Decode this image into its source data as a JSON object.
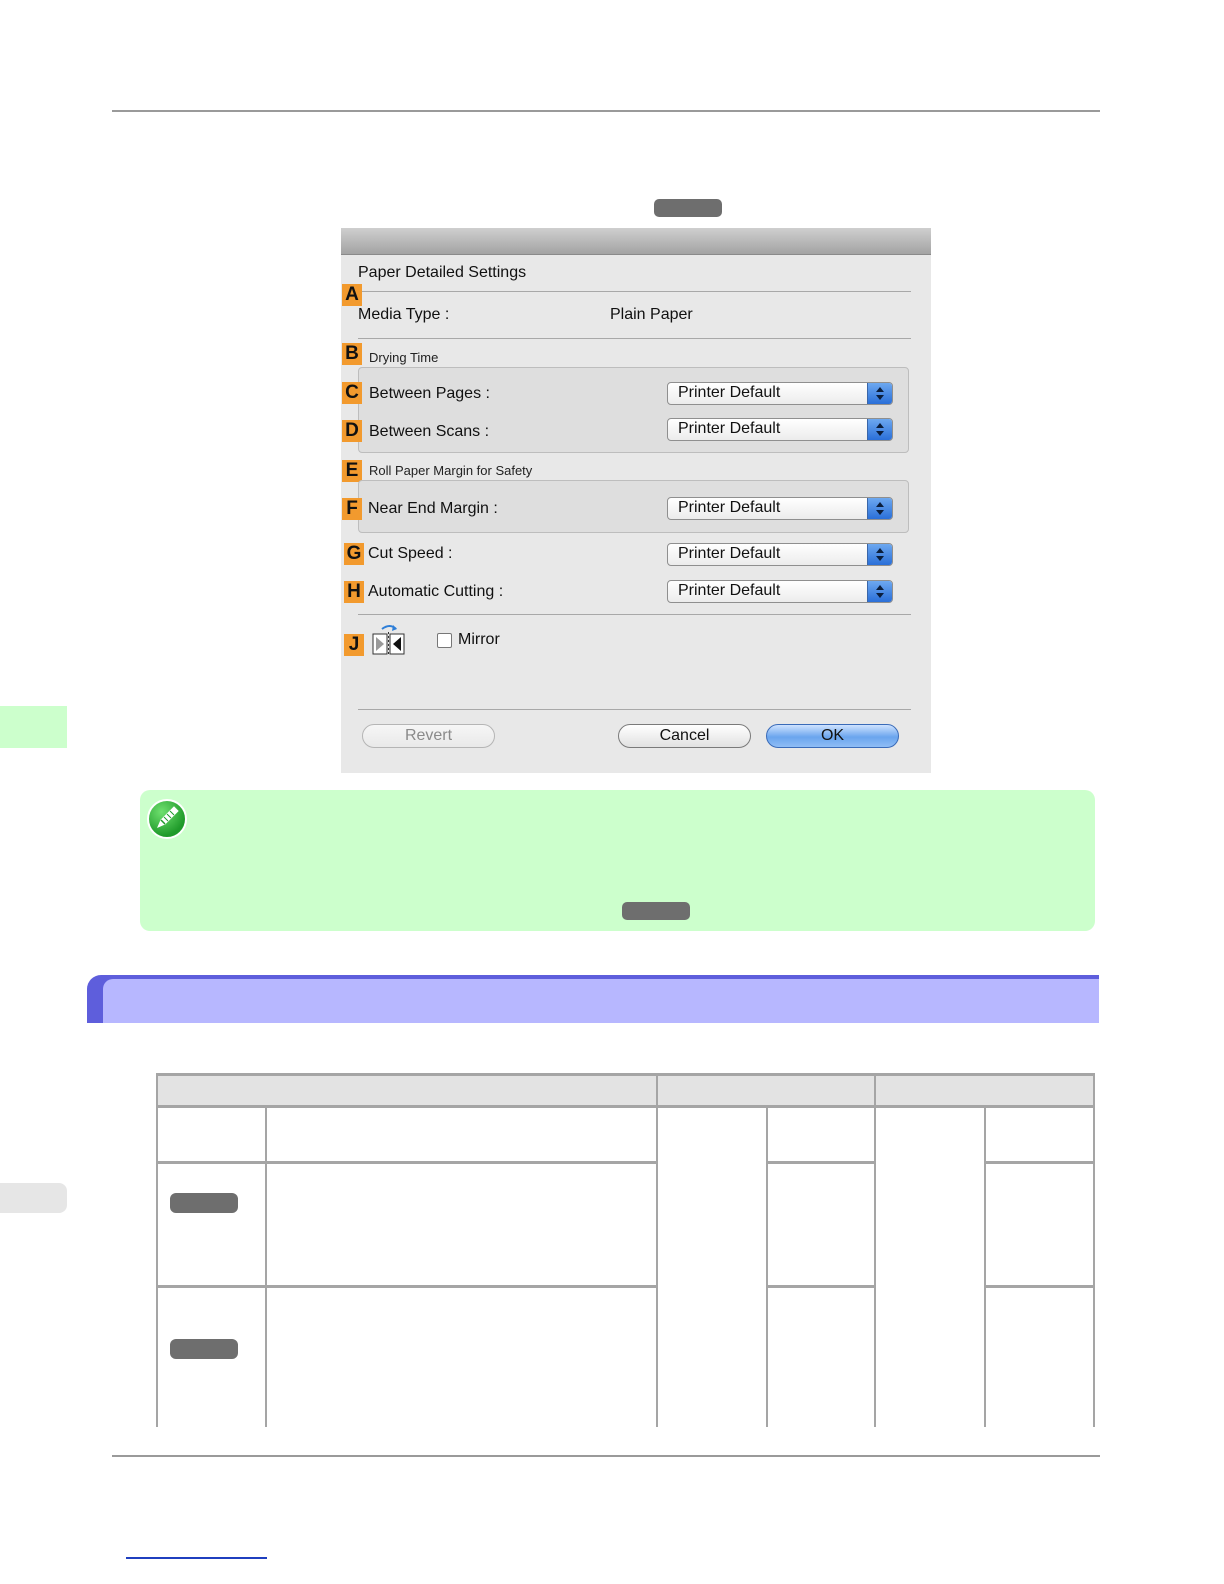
{
  "dialog": {
    "title": "Paper Detailed Settings",
    "media_type_label": "Media Type :",
    "media_type_value": "Plain Paper",
    "drying_time_group": "Drying Time",
    "between_pages_label": "Between Pages :",
    "between_scans_label": "Between Scans :",
    "roll_margin_group": "Roll Paper Margin for Safety",
    "near_end_margin_label": "Near End Margin :",
    "cut_speed_label": "Cut Speed :",
    "automatic_cutting_label": "Automatic Cutting :",
    "select_value": "Printer Default",
    "mirror_label": "Mirror",
    "mirror_checked": false,
    "buttons": {
      "revert": "Revert",
      "cancel": "Cancel",
      "ok": "OK"
    }
  },
  "callouts": {
    "a": "A",
    "b": "B",
    "c": "C",
    "d": "D",
    "e": "E",
    "f": "F",
    "g": "G",
    "h": "H",
    "j": "J"
  },
  "colors": {
    "callout": "#f29a2e",
    "note_background": "#ccffcc",
    "section_band": "#b7b7ff",
    "side_tab_active": "#ccffcc",
    "side_tab_inactive": "#e6e6e6"
  }
}
